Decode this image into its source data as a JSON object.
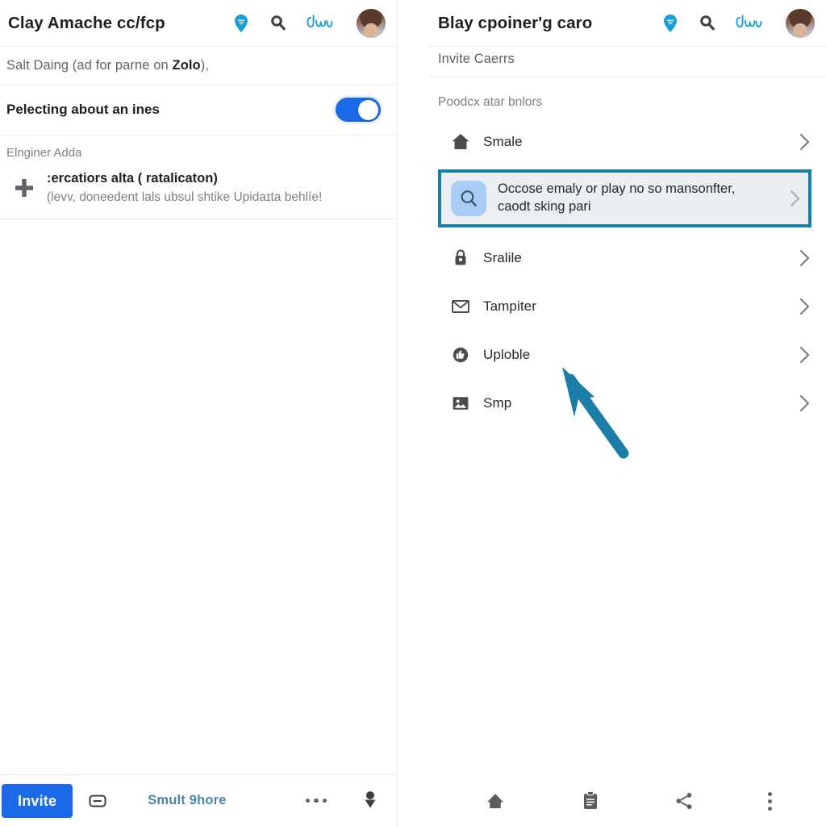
{
  "left_panel": {
    "appbar": {
      "title": "Clay Amache cc/fcp",
      "icons": [
        "location-pin-icon",
        "search-icon",
        "squiggle-icon",
        "avatar"
      ]
    },
    "note": {
      "prefix": "Salt Daing (ad for parne on ",
      "emphasis": "Zolo",
      "suffix": "),"
    },
    "toggle": {
      "label": "Pelecting about an ines",
      "state": "on"
    },
    "group_label": "Elnginer Adda",
    "add_item": {
      "title": ":ercatiors alta ( ratalicaton)",
      "subtitle": "(levv, doneedent lals ubsul shtike Upidaɪta behlíe!"
    },
    "bottom_bar": {
      "invite_label": "Invite",
      "share_text": "Smult 9hore",
      "icons": [
        "card-icon",
        "more-dots-icon",
        "mic-icon"
      ]
    }
  },
  "right_panel": {
    "appbar": {
      "title": "Blay cpoiner'g caro",
      "icons": [
        "location-pin-icon",
        "search-icon",
        "squiggle-icon",
        "avatar"
      ]
    },
    "section_header": "Invite Caerrs",
    "section_sub": "Poodcx atar bnlors",
    "rows": [
      {
        "icon": "home-icon",
        "label": "Smale"
      },
      {
        "icon": "lock-icon",
        "label": "Sralile"
      },
      {
        "icon": "mail-icon",
        "label": "Tampiter"
      },
      {
        "icon": "thumbs-up-icon",
        "label": "Uploble"
      },
      {
        "icon": "image-icon",
        "label": "Smp"
      }
    ],
    "highlighted_row": {
      "icon": "search-icon",
      "text": "Occose emaly or play no so mansonfter, caodt sking pari"
    },
    "bottom_nav": [
      "home-icon",
      "clipboard-icon",
      "share-icon",
      "kebab-menu-icon"
    ]
  },
  "annotation": {
    "arrow_color": "#1b7ea6",
    "highlight_border_color": "#1b7ea6",
    "highlight_bg_color": "#eceff1",
    "accent_blue": "#1a6ae8"
  }
}
